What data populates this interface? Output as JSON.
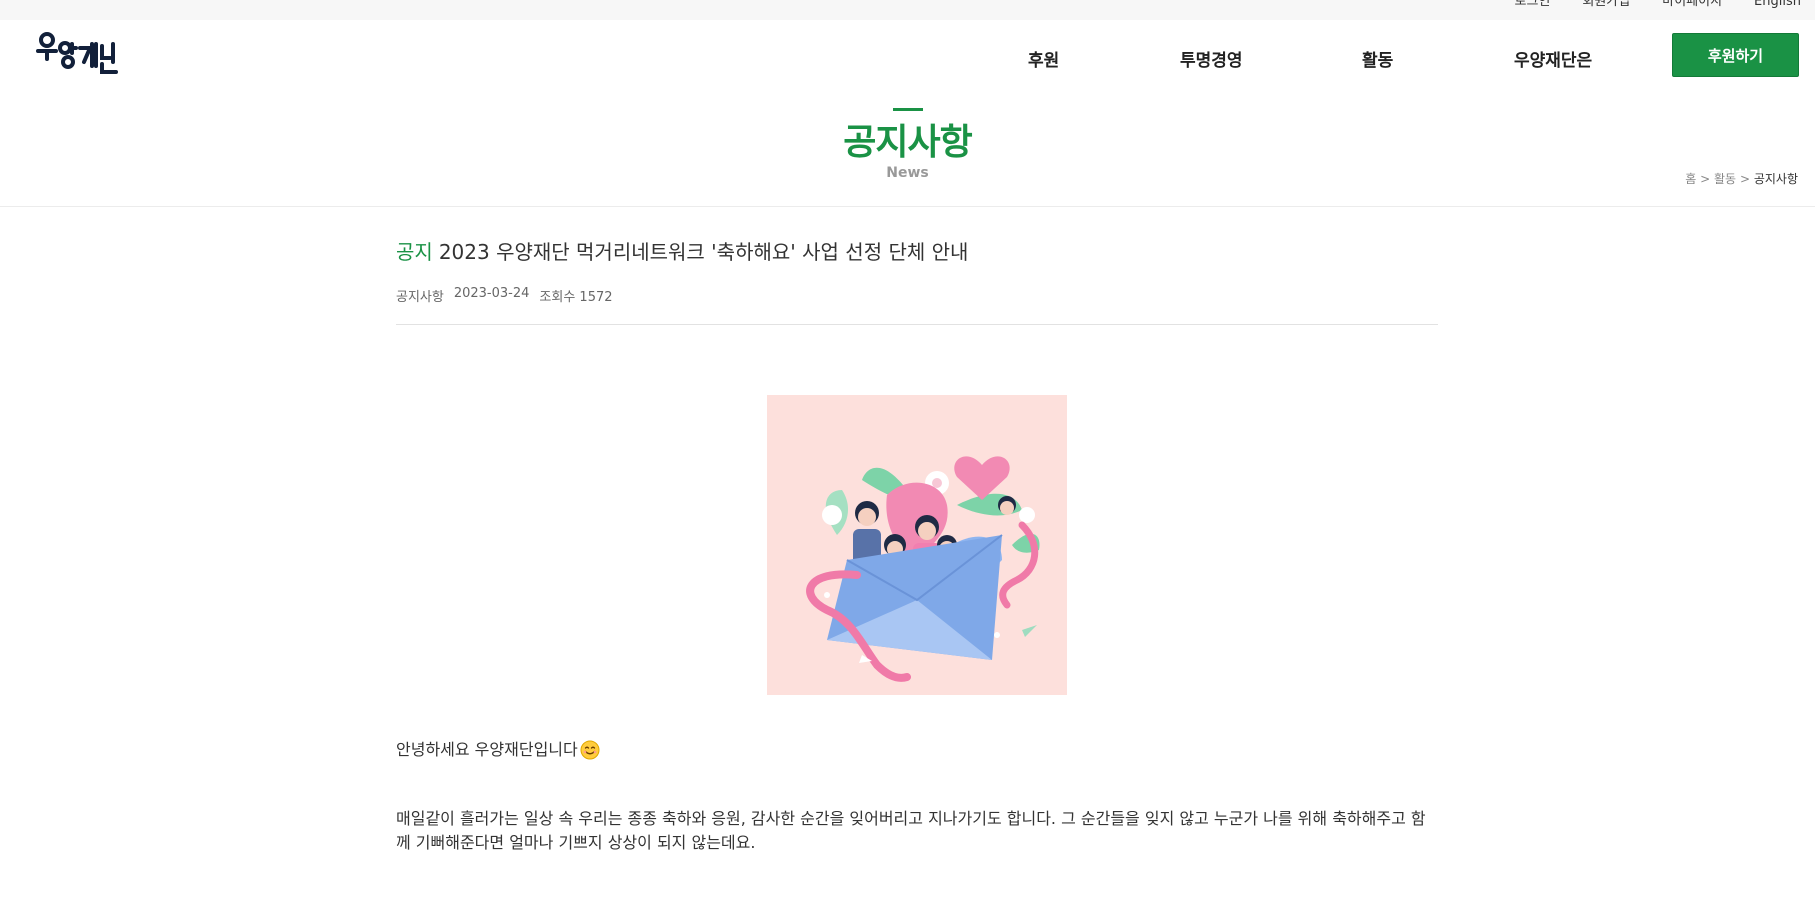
{
  "util_links": [
    "로그인",
    "회원가입",
    "마이페이지",
    "English"
  ],
  "logo": {
    "text": "우양재단"
  },
  "nav": {
    "items": [
      "후원",
      "투명경영",
      "활동",
      "우양재단은"
    ],
    "cta_label": "후원하기"
  },
  "page": {
    "title": "공지사항",
    "subtitle": "News"
  },
  "breadcrumb": {
    "home": "홈",
    "sep": ">",
    "level1": "활동",
    "current": "공지사항"
  },
  "article": {
    "category": "공지",
    "title": "2023 우양재단 먹거리네트워크 '축하해요' 사업 선정 단체 안내",
    "meta_board": "공지사항",
    "meta_date": "2023-03-24",
    "meta_views": "조회수 1572",
    "greeting": "안녕하세요 우양재단입니다",
    "paragraph": "매일같이 흘러가는 일상 속 우리는 종종 축하와 응원, 감사한 순간을 잊어버리고 지나가기도 합니다. 그 순간들을 잊지 않고 누군가 나를 위해 축하해주고 함께 기뻐해준다면 얼마나 기쁘지 상상이 되지 않는데요."
  },
  "colors": {
    "brand_green": "#1a9245",
    "image_bg": "#fde0dc",
    "envelope": "#7fa8e8",
    "ribbon": "#f07aa8"
  },
  "icons": [
    "smile-emoji-icon"
  ]
}
